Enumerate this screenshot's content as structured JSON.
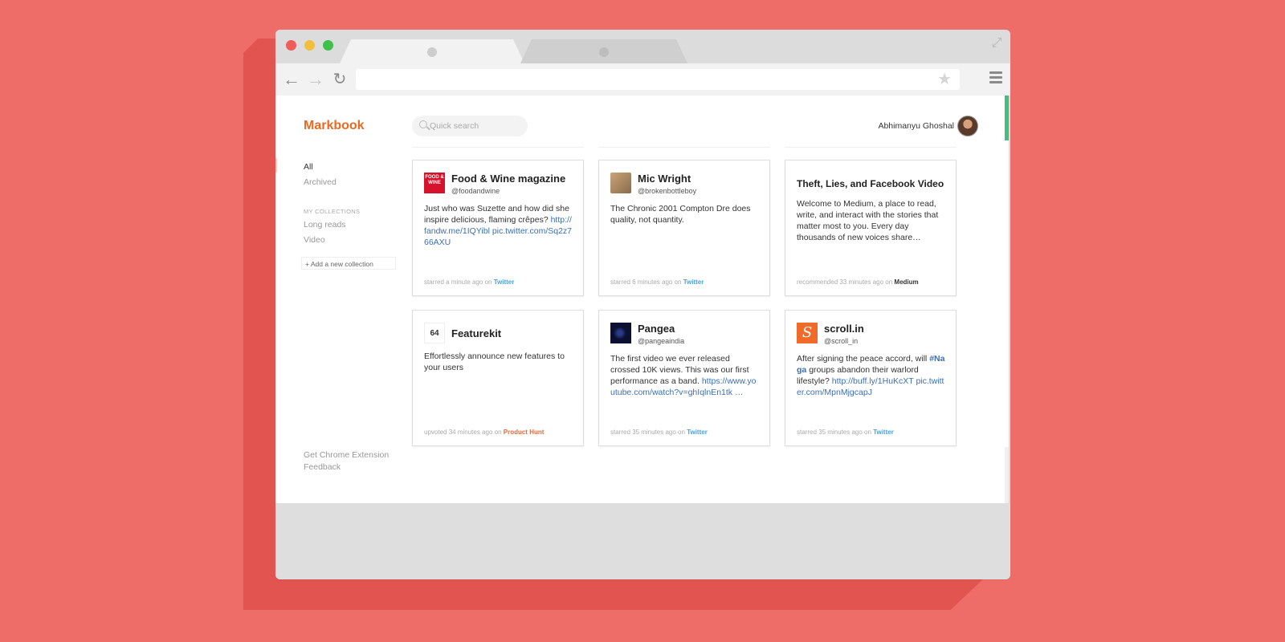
{
  "app": {
    "brand": "Markbook",
    "search_placeholder": "Quick search",
    "user_name": "Abhimanyu Ghoshal",
    "colors": {
      "background": "#ee6d69",
      "brand": "#ea6a22",
      "accent": "#3fc07d",
      "twitter": "#4aa3df",
      "product_hunt": "#e66a3a"
    }
  },
  "sidebar": {
    "filters": [
      {
        "label": "All",
        "active": true
      },
      {
        "label": "Archived",
        "active": false
      }
    ],
    "collections_header": "MY COLLECTIONS",
    "collections": [
      "Long reads",
      "Video"
    ],
    "add_collection": "+ Add a new collection",
    "footer_links": [
      "Get Chrome Extension",
      "Feedback"
    ]
  },
  "cards": [
    {
      "title": "Food & Wine magazine",
      "handle": "@foodandwine",
      "thumb_text": "FOOD & WINE",
      "body_text": "Just who was Suzette and how did she inspire delicious, flaming crêpes?",
      "body_link": "http://fandw.me/1IQYibl pic.twitter.com/Sq2z766AXU",
      "footer_action": "starred a minute ago on",
      "footer_source": "Twitter"
    },
    {
      "title": "Mic Wright",
      "handle": "@brokenbottleboy",
      "body_text": "The Chronic 2001 Compton Dre does quality, not quantity.",
      "footer_action": "starred 6 minutes ago on",
      "footer_source": "Twitter"
    },
    {
      "title": "Theft, Lies, and Facebook Video",
      "body_text": "Welcome to Medium, a place to read, write, and interact with the stories that matter most to you. Every day thousands of new voices share…",
      "footer_action": "recommended 33 minutes ago on",
      "footer_source": "Medium"
    },
    {
      "title": "Featurekit",
      "thumb_text": "64",
      "body_text": "Effortlessly announce new features to your users",
      "footer_action": "upvoted 34 minutes ago on",
      "footer_source": "Product Hunt"
    },
    {
      "title": "Pangea",
      "handle": "@pangeaindia",
      "body_text": "The first video we ever released crossed 10K views. This was our first performance as a band.",
      "body_link": "https://www.youtube.com/watch?v=ghIqlnEn1tk …",
      "footer_action": "starred 35 minutes ago on",
      "footer_source": "Twitter"
    },
    {
      "title": "scroll.in",
      "handle": "@scroll_in",
      "thumb_text": "S",
      "body_pre": "After signing the peace accord, will",
      "body_tag": "#Naga",
      "body_text": "groups abandon their warlord lifestyle?",
      "body_link": "http://buff.ly/1HuKcXT pic.twitter.com/MpnMjgcapJ",
      "footer_action": "starred 35 minutes ago on",
      "footer_source": "Twitter"
    }
  ]
}
